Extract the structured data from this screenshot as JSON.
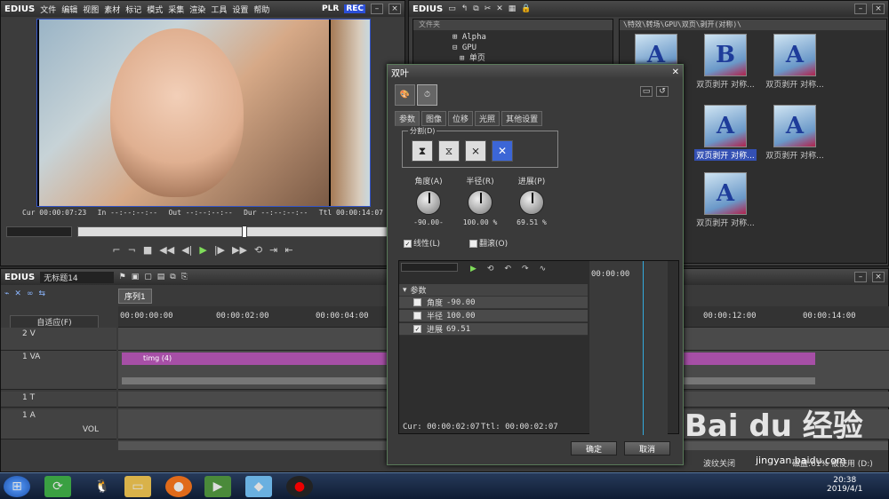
{
  "preview": {
    "app_name": "EDIUS",
    "menu": [
      "文件",
      "编辑",
      "视图",
      "素材",
      "标记",
      "模式",
      "采集",
      "渲染",
      "工具",
      "设置",
      "帮助"
    ],
    "plr": "PLR",
    "rec": "REC",
    "timecodes": {
      "cur": "Cur 00:00:07:23",
      "in": "In --:--:--:--",
      "out": "Out --:--:--:--",
      "dur": "Dur --:--:--:--",
      "ttl": "Ttl 00:00:14:07"
    }
  },
  "bin": {
    "app_name": "EDIUS",
    "tree_header": "文件夹",
    "tree_items": [
      "Alpha",
      "GPU",
      "单页"
    ],
    "path": "\\特效\\转场\\GPU\\双页\\剥开(对称)\\",
    "thumbs": [
      {
        "letter": "A",
        "caption": "",
        "selected": false
      },
      {
        "letter": "B",
        "caption": "双页剥开 对称...",
        "selected": false
      },
      {
        "letter": "A",
        "caption": "双页剥开 对称...",
        "selected": false
      },
      {
        "letter": "A",
        "caption": "双页剥开 对称...",
        "selected": true
      },
      {
        "letter": "A",
        "caption": "双页剥开 对称...",
        "selected": false
      },
      {
        "letter": "A",
        "caption": "双页剥开 对称...",
        "selected": false
      }
    ]
  },
  "timeline": {
    "app_name": "EDIUS",
    "project": "无标题14",
    "sequence_tab": "序列1",
    "mode": "自适应(F)",
    "ruler": [
      "00:00:00:00",
      "00:00:02:00",
      "00:00:04:00",
      "00:00:12:00",
      "00:00:14:00"
    ],
    "tracks": [
      "2 V",
      "1 VA",
      "1 T",
      "1 A"
    ],
    "vol": "VOL",
    "clip_label": "timg (4)",
    "status_left": "波纹关闭",
    "status_right": "磁盘:61% 被使用 (D:)"
  },
  "dialog": {
    "title": "双叶",
    "tabs": [
      "参数",
      "图像",
      "位移",
      "光照",
      "其他设置"
    ],
    "group_label": "分割(D)",
    "knobs": [
      {
        "label": "角度(A)",
        "value": "-90.00-"
      },
      {
        "label": "半径(R)",
        "value": "100.00 %"
      },
      {
        "label": "进展(P)",
        "value": "69.51 %"
      }
    ],
    "checkbox_linear": "线性(L)",
    "checkbox_flip": "翻滚(O)",
    "kf_header": "参数",
    "kf_rows": [
      {
        "name": "角度",
        "value": "-90.00"
      },
      {
        "name": "半径",
        "value": "100.00"
      },
      {
        "name": "进展",
        "value": "69.51"
      }
    ],
    "kf_time": "00:00:00",
    "cur": "Cur: 00:00:02:07",
    "ttl": "Ttl: 00:00:02:07",
    "ok": "确定",
    "cancel": "取消"
  },
  "taskbar": {
    "time": "20:38",
    "date": "2019/4/1"
  },
  "watermark": {
    "brand": "Bai du 经验",
    "url": "jingyan.baidu.com"
  }
}
